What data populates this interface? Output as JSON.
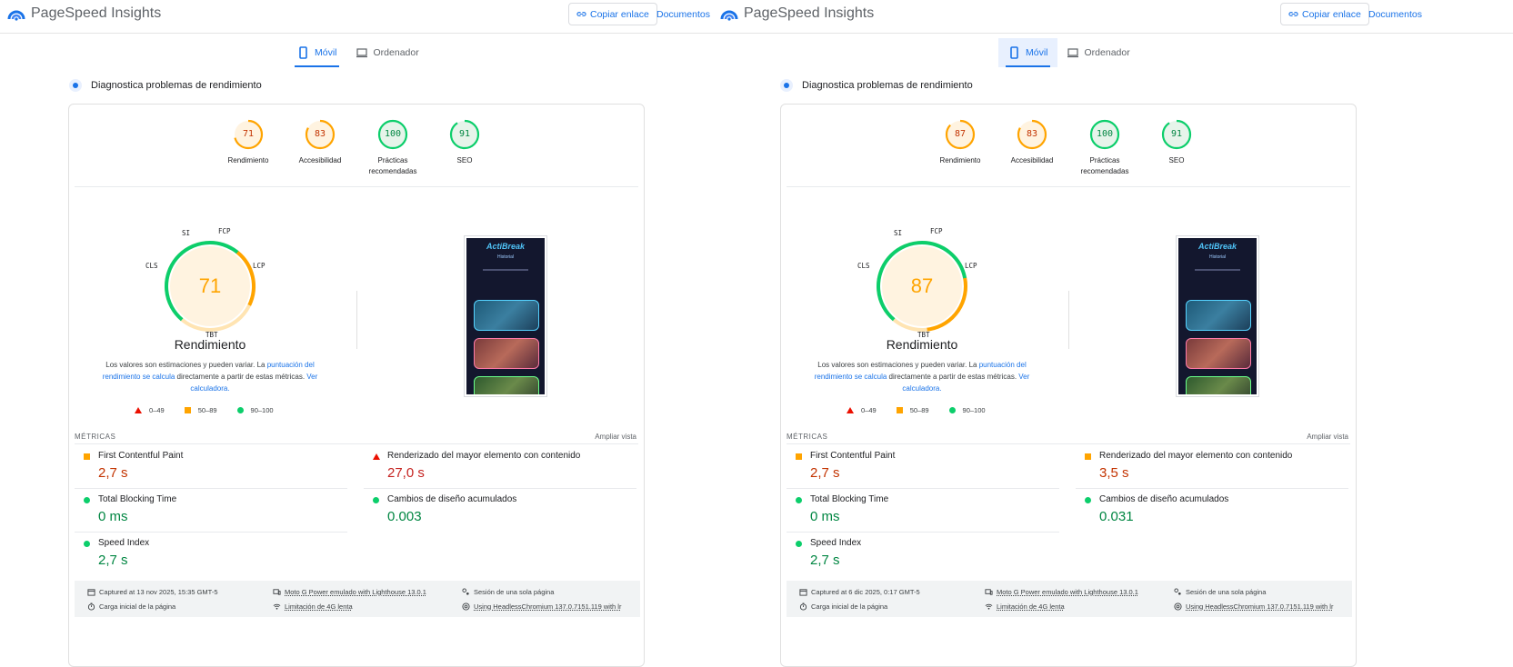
{
  "brand": {
    "name": "PageSpeed Insights"
  },
  "header": {
    "copy_link": "Copiar enlace",
    "docs": "Documentos"
  },
  "colors": {
    "fail": "#eb0f00",
    "average": "#ffa400",
    "pass": "#0cce6b",
    "accent": "#1a73e8"
  },
  "left": {
    "tabs": {
      "mobile": "Móvil",
      "desktop": "Ordenador"
    },
    "diagnose": "Diagnostica problemas de rendimiento",
    "categories": [
      {
        "score": "71",
        "label": "Rendimiento",
        "level": "average"
      },
      {
        "score": "83",
        "label": "Accesibilidad",
        "level": "average"
      },
      {
        "score": "100",
        "label": "Prácticas recomendadas",
        "level": "pass"
      },
      {
        "score": "91",
        "label": "SEO",
        "level": "pass"
      }
    ],
    "perf": {
      "score": "71",
      "title": "Rendimiento",
      "tags": {
        "si": "SI",
        "fcp": "FCP",
        "lcp": "LCP",
        "tbt": "TBT",
        "cls": "CLS"
      }
    },
    "note": {
      "pre": "Los valores son estimaciones y pueden variar. La ",
      "link1": "puntuación del rendimiento se calcula",
      "mid": " directamente a partir de estas métricas. ",
      "link2": "Ver calculadora."
    },
    "legend": {
      "fail": "0–49",
      "average": "50–89",
      "pass": "90–100"
    },
    "screenshot": {
      "app": "ActiBreak",
      "sub": "Historial"
    },
    "metrics_header": "MÉTRICAS",
    "expand": "Ampliar vista",
    "metrics": {
      "fcp": {
        "name": "First Contentful Paint",
        "value": "2,7 s",
        "level": "average"
      },
      "lcp": {
        "name": "Renderizado del mayor elemento con contenido",
        "value": "27,0 s",
        "level": "fail"
      },
      "tbt": {
        "name": "Total Blocking Time",
        "value": "0 ms",
        "level": "pass"
      },
      "cls": {
        "name": "Cambios de diseño acumulados",
        "value": "0.003",
        "level": "pass"
      },
      "si": {
        "name": "Speed Index",
        "value": "2,7 s",
        "level": "pass"
      }
    },
    "footer": {
      "captured": "Captured at 13 nov 2025, 15:35 GMT-5",
      "device": "Moto G Power emulado with Lighthouse 13.0.1",
      "session": "Sesión de una sola página",
      "load": "Carga inicial de la página",
      "throttle": "Limitación de 4G lenta",
      "browser": "Using HeadlessChromium 137.0.7151.119 with lr"
    }
  },
  "right": {
    "tabs": {
      "mobile": "Móvil",
      "desktop": "Ordenador"
    },
    "diagnose": "Diagnostica problemas de rendimiento",
    "categories": [
      {
        "score": "87",
        "label": "Rendimiento",
        "level": "average"
      },
      {
        "score": "83",
        "label": "Accesibilidad",
        "level": "average"
      },
      {
        "score": "100",
        "label": "Prácticas recomendadas",
        "level": "pass"
      },
      {
        "score": "91",
        "label": "SEO",
        "level": "pass"
      }
    ],
    "perf": {
      "score": "87",
      "title": "Rendimiento",
      "tags": {
        "si": "SI",
        "fcp": "FCP",
        "lcp": "LCP",
        "tbt": "TBT",
        "cls": "CLS"
      }
    },
    "note": {
      "pre": "Los valores son estimaciones y pueden variar. La ",
      "link1": "puntuación del rendimiento se calcula",
      "mid": " directamente a partir de estas métricas. ",
      "link2": "Ver calculadora."
    },
    "legend": {
      "fail": "0–49",
      "average": "50–89",
      "pass": "90–100"
    },
    "screenshot": {
      "app": "ActiBreak",
      "sub": "Historial"
    },
    "metrics_header": "MÉTRICAS",
    "expand": "Ampliar vista",
    "metrics": {
      "fcp": {
        "name": "First Contentful Paint",
        "value": "2,7 s",
        "level": "average"
      },
      "lcp": {
        "name": "Renderizado del mayor elemento con contenido",
        "value": "3,5 s",
        "level": "average"
      },
      "tbt": {
        "name": "Total Blocking Time",
        "value": "0 ms",
        "level": "pass"
      },
      "cls": {
        "name": "Cambios de diseño acumulados",
        "value": "0.031",
        "level": "pass"
      },
      "si": {
        "name": "Speed Index",
        "value": "2,7 s",
        "level": "pass"
      }
    },
    "footer": {
      "captured": "Captured at 6 dic 2025, 0:17 GMT-5",
      "device": "Moto G Power emulado with Lighthouse 13.0.1",
      "session": "Sesión de una sola página",
      "load": "Carga inicial de la página",
      "throttle": "Limitación de 4G lenta",
      "browser": "Using HeadlessChromium 137.0.7151.119 with lr"
    }
  }
}
